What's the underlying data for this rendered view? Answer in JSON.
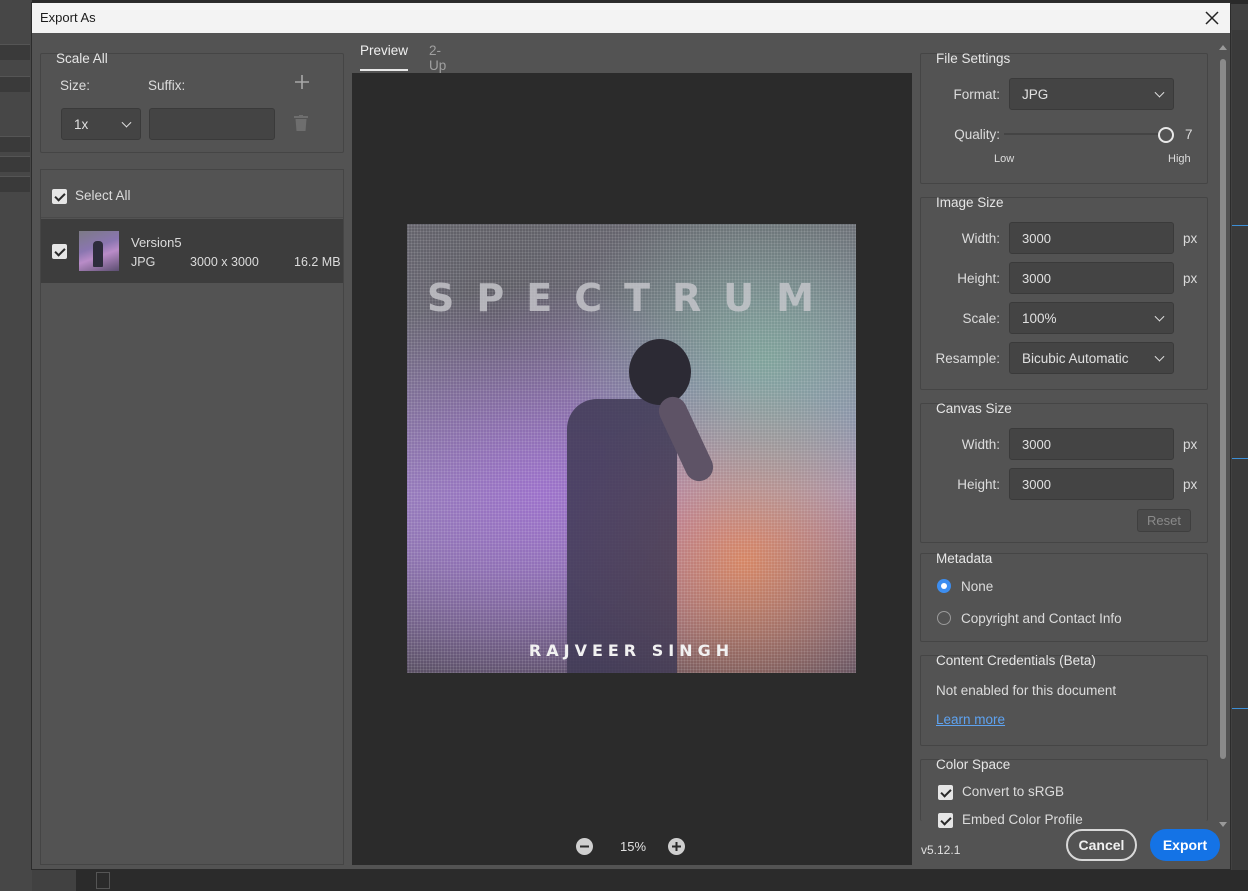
{
  "dialog": {
    "title": "Export As"
  },
  "scale_all": {
    "title": "Scale All",
    "size_label": "Size:",
    "suffix_label": "Suffix:",
    "size_value": "1x",
    "suffix_value": ""
  },
  "assets": {
    "select_all_label": "Select All",
    "items": [
      {
        "name": "Version5",
        "format": "JPG",
        "dimensions": "3000 x 3000",
        "file_size": "16.2 MB"
      }
    ]
  },
  "preview": {
    "tabs": [
      {
        "label": "Preview"
      },
      {
        "label": "2-Up"
      }
    ],
    "artwork_title": "SPECTRUM",
    "artwork_artist": "RAJVEER SINGH",
    "zoom": "15%"
  },
  "file_settings": {
    "title": "File Settings",
    "format_label": "Format:",
    "format_value": "JPG",
    "quality_label": "Quality:",
    "quality_value": "7",
    "quality_low": "Low",
    "quality_high": "High"
  },
  "image_size": {
    "title": "Image Size",
    "width_label": "Width:",
    "width_value": "3000",
    "height_label": "Height:",
    "height_value": "3000",
    "scale_label": "Scale:",
    "scale_value": "100%",
    "resample_label": "Resample:",
    "resample_value": "Bicubic Automatic",
    "unit": "px"
  },
  "canvas_size": {
    "title": "Canvas Size",
    "width_label": "Width:",
    "width_value": "3000",
    "height_label": "Height:",
    "height_value": "3000",
    "unit": "px",
    "reset_label": "Reset"
  },
  "metadata": {
    "title": "Metadata",
    "options": [
      {
        "label": "None",
        "selected": true
      },
      {
        "label": "Copyright and Contact Info",
        "selected": false
      }
    ]
  },
  "content_credentials": {
    "title": "Content Credentials (Beta)",
    "status": "Not enabled for this document",
    "link": "Learn more"
  },
  "color_space": {
    "title": "Color Space",
    "convert_label": "Convert to sRGB",
    "embed_label": "Embed Color Profile"
  },
  "footer": {
    "version": "v5.12.1",
    "cancel_label": "Cancel",
    "export_label": "Export"
  },
  "colors": {
    "accent": "#1473e6",
    "radio": "#3d8ef0",
    "link": "#5ea3f1"
  },
  "icons": {
    "add": "plus-icon",
    "delete": "trash-icon",
    "close": "close-icon",
    "zoom_in": "zoom-in-icon",
    "zoom_out": "zoom-out-icon"
  }
}
